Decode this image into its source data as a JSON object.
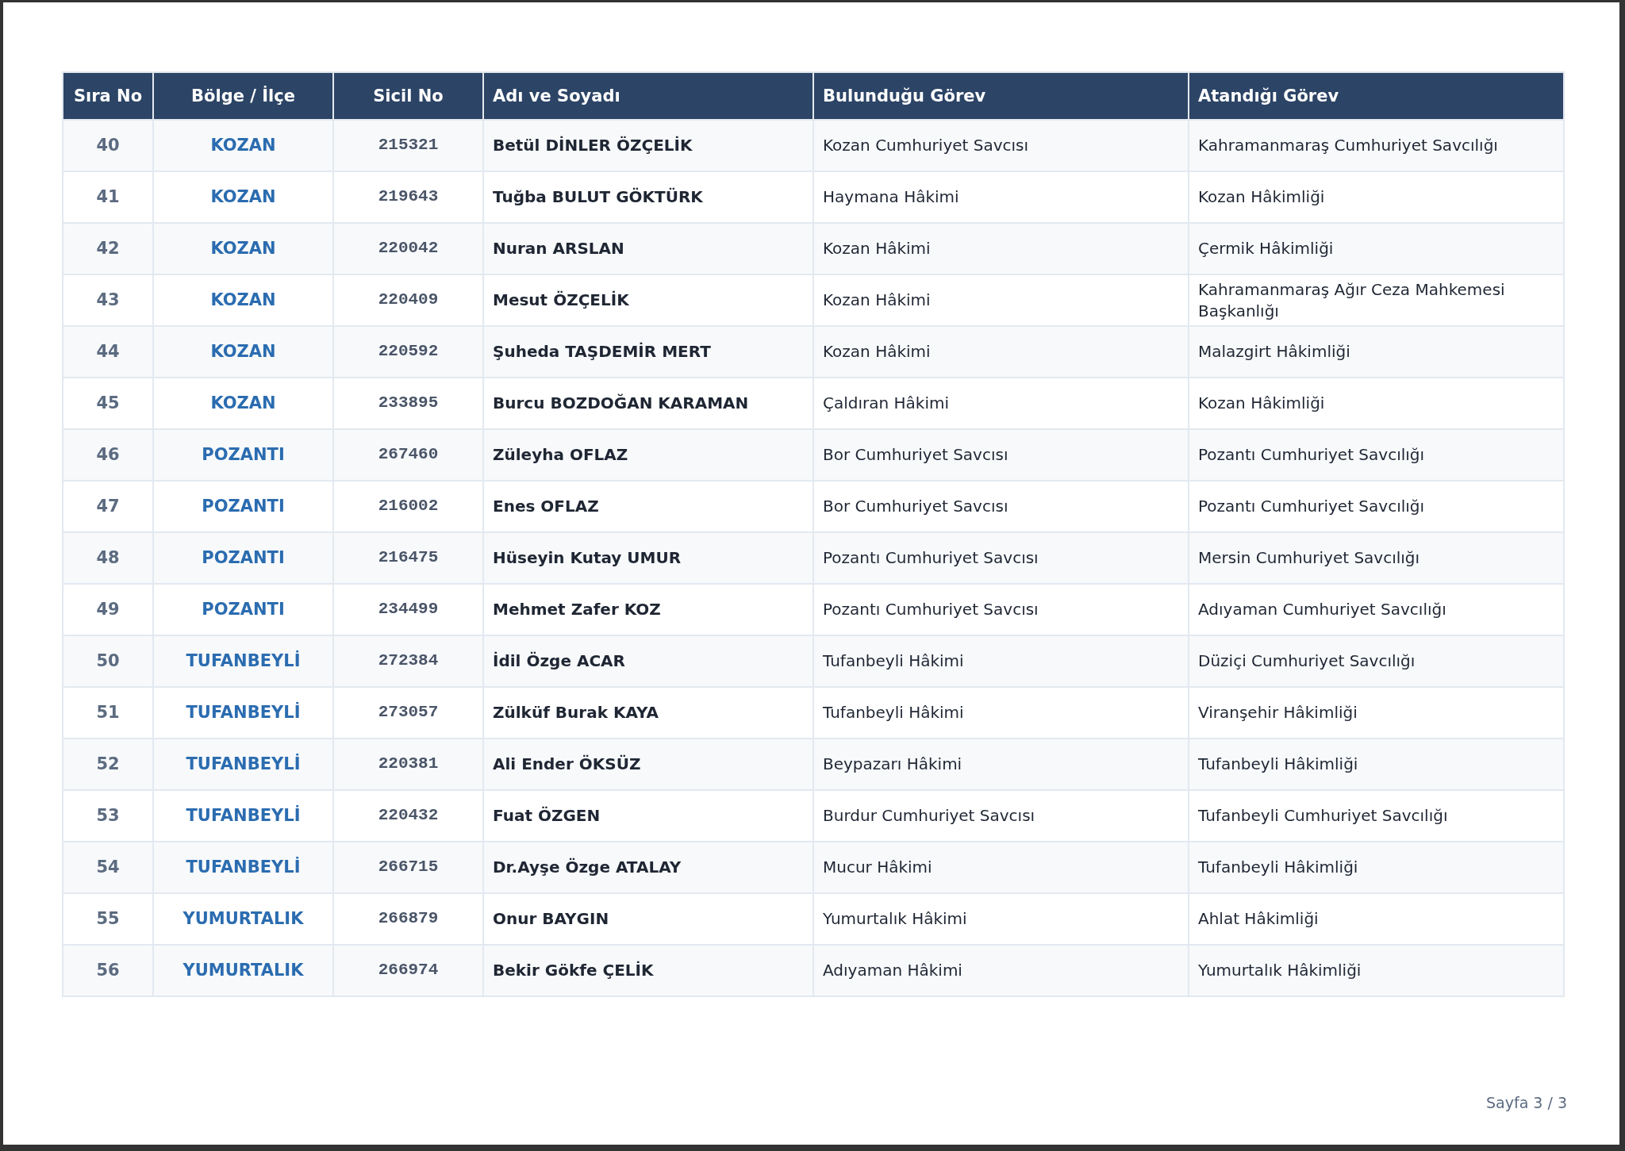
{
  "table": {
    "columns": [
      "Sıra No",
      "Bölge / İlçe",
      "Sicil No",
      "Adı ve Soyadı",
      "Bulunduğu Görev",
      "Atandığı Görev"
    ],
    "rows": [
      {
        "sira_no": "40",
        "bolge": "KOZAN",
        "sicil_no": "215321",
        "ad_soyad": "Betül DİNLER ÖZÇELİK",
        "bulundugu": "Kozan Cumhuriyet Savcısı",
        "atandigi": "Kahramanmaraş Cumhuriyet Savcılığı"
      },
      {
        "sira_no": "41",
        "bolge": "KOZAN",
        "sicil_no": "219643",
        "ad_soyad": "Tuğba BULUT GÖKTÜRK",
        "bulundugu": "Haymana Hâkimi",
        "atandigi": "Kozan Hâkimliği"
      },
      {
        "sira_no": "42",
        "bolge": "KOZAN",
        "sicil_no": "220042",
        "ad_soyad": "Nuran ARSLAN",
        "bulundugu": "Kozan Hâkimi",
        "atandigi": "Çermik Hâkimliği"
      },
      {
        "sira_no": "43",
        "bolge": "KOZAN",
        "sicil_no": "220409",
        "ad_soyad": "Mesut ÖZÇELİK",
        "bulundugu": "Kozan Hâkimi",
        "atandigi": "Kahramanmaraş Ağır Ceza Mahkemesi Başkanlığı"
      },
      {
        "sira_no": "44",
        "bolge": "KOZAN",
        "sicil_no": "220592",
        "ad_soyad": "Şuheda TAŞDEMİR MERT",
        "bulundugu": "Kozan Hâkimi",
        "atandigi": "Malazgirt Hâkimliği"
      },
      {
        "sira_no": "45",
        "bolge": "KOZAN",
        "sicil_no": "233895",
        "ad_soyad": "Burcu BOZDOĞAN KARAMAN",
        "bulundugu": "Çaldıran Hâkimi",
        "atandigi": "Kozan Hâkimliği"
      },
      {
        "sira_no": "46",
        "bolge": "POZANTI",
        "sicil_no": "267460",
        "ad_soyad": "Züleyha OFLAZ",
        "bulundugu": "Bor Cumhuriyet Savcısı",
        "atandigi": "Pozantı Cumhuriyet Savcılığı"
      },
      {
        "sira_no": "47",
        "bolge": "POZANTI",
        "sicil_no": "216002",
        "ad_soyad": "Enes OFLAZ",
        "bulundugu": "Bor Cumhuriyet Savcısı",
        "atandigi": "Pozantı Cumhuriyet Savcılığı"
      },
      {
        "sira_no": "48",
        "bolge": "POZANTI",
        "sicil_no": "216475",
        "ad_soyad": "Hüseyin Kutay UMUR",
        "bulundugu": "Pozantı Cumhuriyet Savcısı",
        "atandigi": "Mersin Cumhuriyet Savcılığı"
      },
      {
        "sira_no": "49",
        "bolge": "POZANTI",
        "sicil_no": "234499",
        "ad_soyad": "Mehmet Zafer KOZ",
        "bulundugu": "Pozantı Cumhuriyet Savcısı",
        "atandigi": "Adıyaman Cumhuriyet Savcılığı"
      },
      {
        "sira_no": "50",
        "bolge": "TUFANBEYLİ",
        "sicil_no": "272384",
        "ad_soyad": "İdil Özge ACAR",
        "bulundugu": "Tufanbeyli Hâkimi",
        "atandigi": "Düziçi Cumhuriyet Savcılığı"
      },
      {
        "sira_no": "51",
        "bolge": "TUFANBEYLİ",
        "sicil_no": "273057",
        "ad_soyad": "Zülküf Burak KAYA",
        "bulundugu": "Tufanbeyli Hâkimi",
        "atandigi": "Viranşehir Hâkimliği"
      },
      {
        "sira_no": "52",
        "bolge": "TUFANBEYLİ",
        "sicil_no": "220381",
        "ad_soyad": "Ali Ender ÖKSÜZ",
        "bulundugu": "Beypazarı Hâkimi",
        "atandigi": "Tufanbeyli Hâkimliği"
      },
      {
        "sira_no": "53",
        "bolge": "TUFANBEYLİ",
        "sicil_no": "220432",
        "ad_soyad": "Fuat ÖZGEN",
        "bulundugu": "Burdur Cumhuriyet Savcısı",
        "atandigi": "Tufanbeyli Cumhuriyet Savcılığı"
      },
      {
        "sira_no": "54",
        "bolge": "TUFANBEYLİ",
        "sicil_no": "266715",
        "ad_soyad": "Dr.Ayşe Özge ATALAY",
        "bulundugu": "Mucur Hâkimi",
        "atandigi": "Tufanbeyli Hâkimliği"
      },
      {
        "sira_no": "55",
        "bolge": "YUMURTALIK",
        "sicil_no": "266879",
        "ad_soyad": "Onur BAYGIN",
        "bulundugu": "Yumurtalık Hâkimi",
        "atandigi": "Ahlat Hâkimliği"
      },
      {
        "sira_no": "56",
        "bolge": "YUMURTALIK",
        "sicil_no": "266974",
        "ad_soyad": "Bekir Gökfe ÇELİK",
        "bulundugu": "Adıyaman Hâkimi",
        "atandigi": "Yumurtalık Hâkimliği"
      }
    ]
  },
  "footer": {
    "page": "Sayfa 3 / 3"
  }
}
